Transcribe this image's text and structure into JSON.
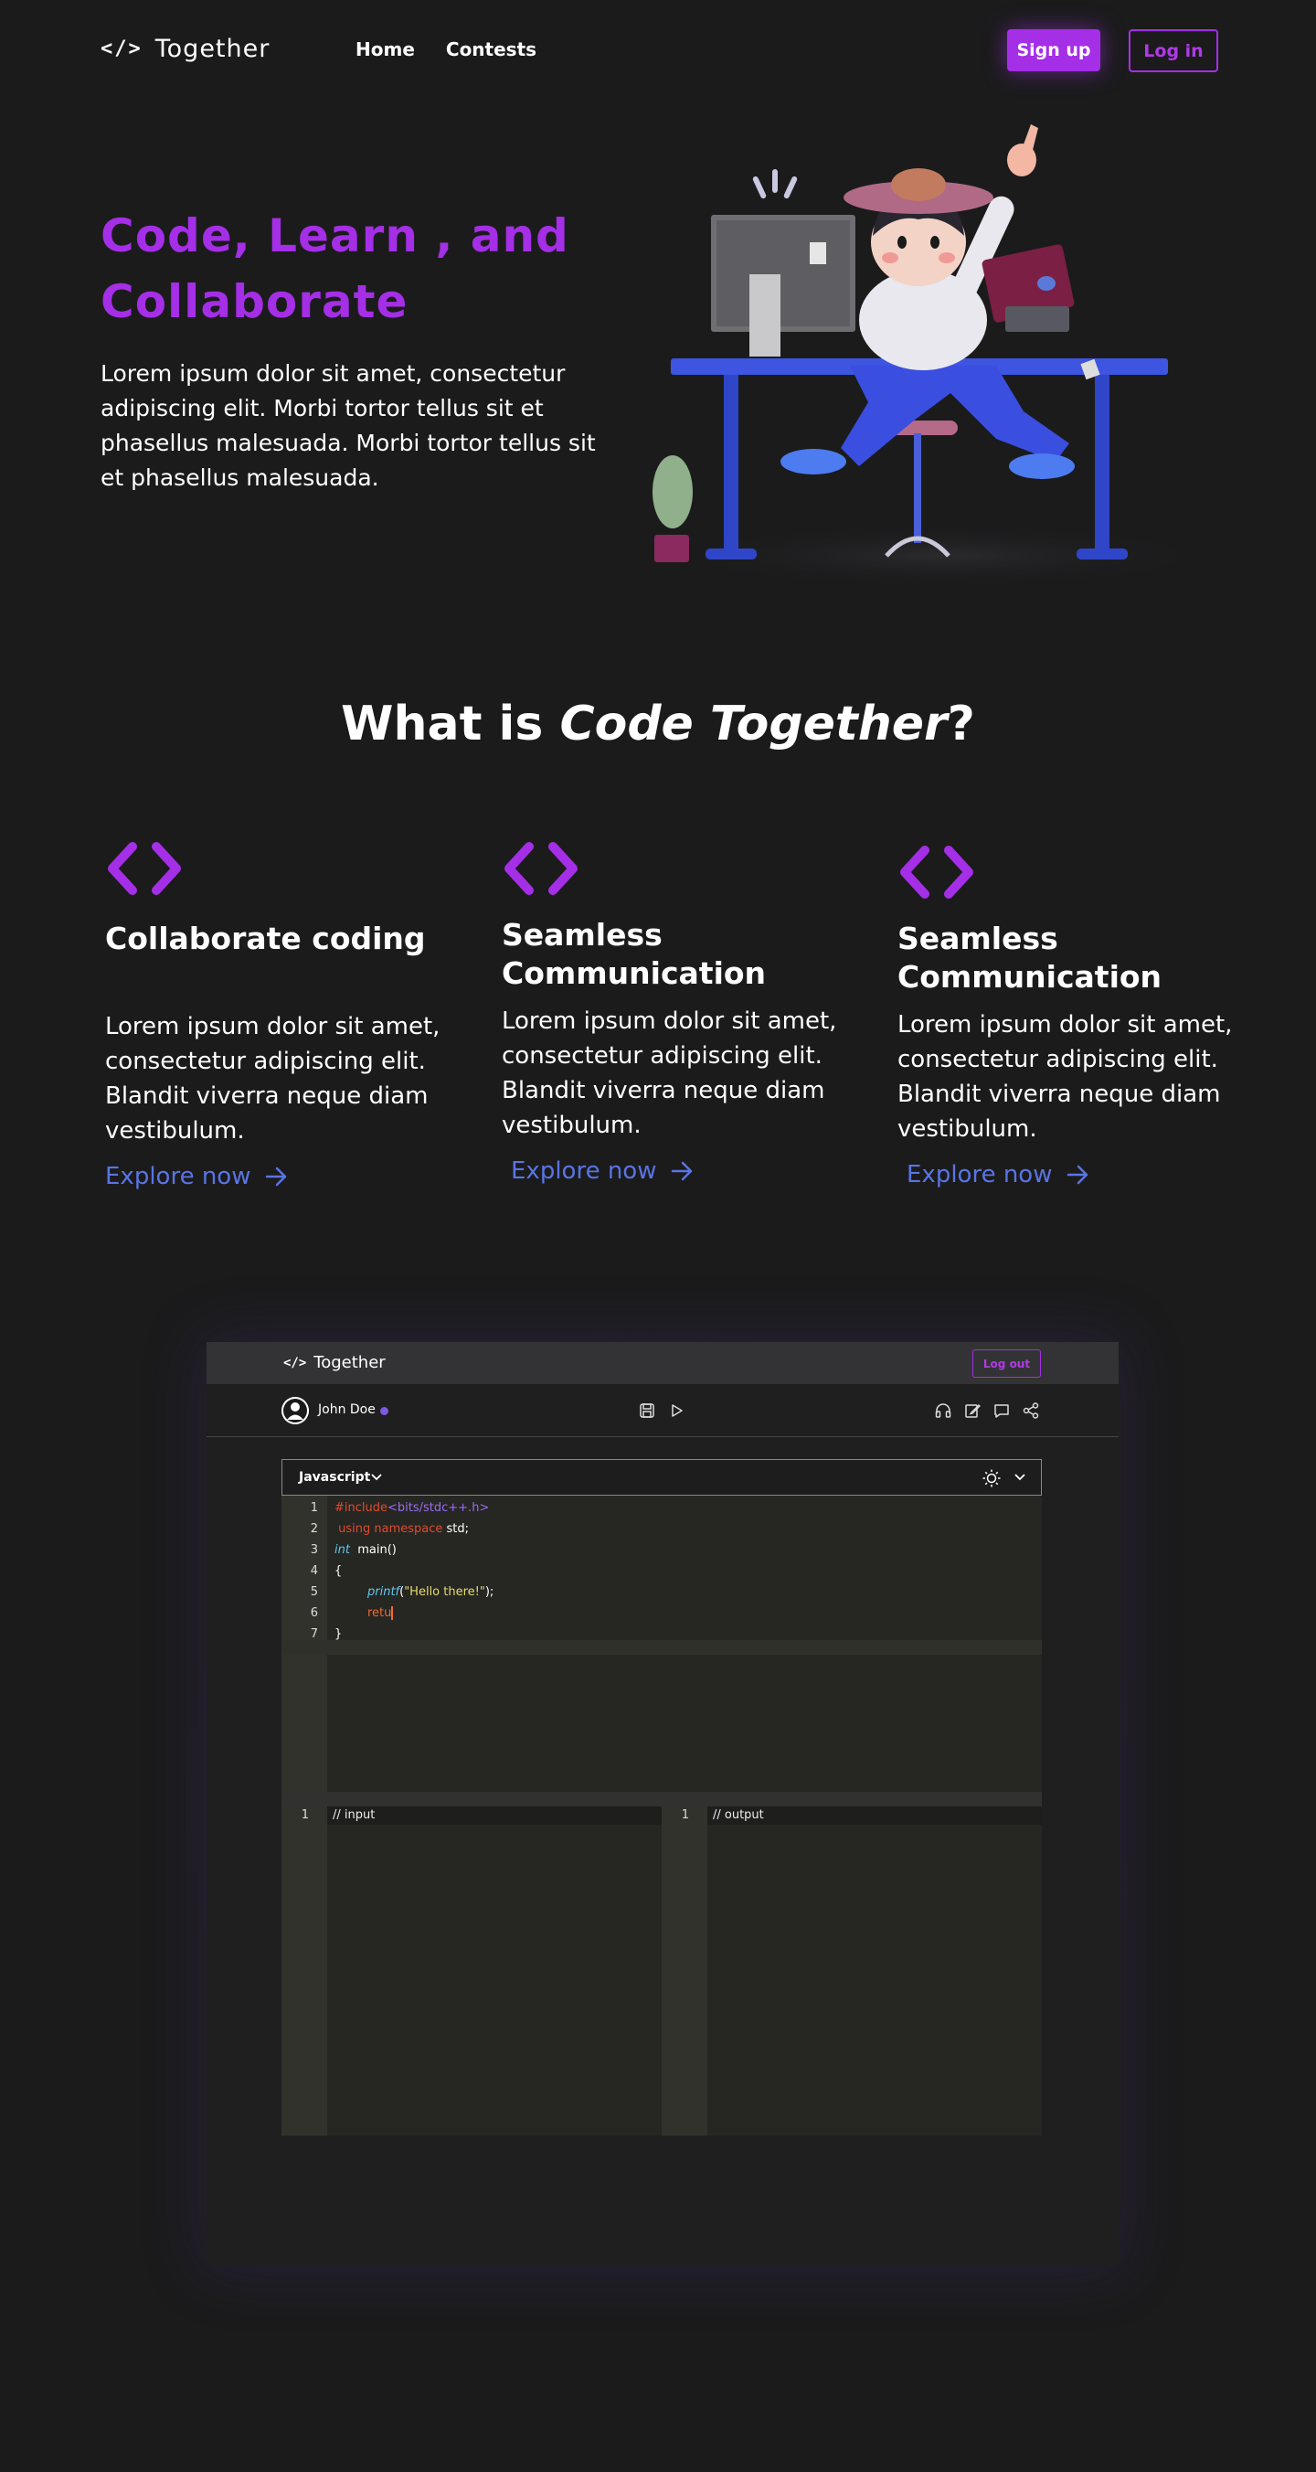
{
  "nav": {
    "logo_glyph": "</>",
    "logo_text": "Together",
    "links": [
      "Home",
      "Contests"
    ],
    "signup_label": "Sign up",
    "login_label": "Log in"
  },
  "hero": {
    "title_line1": "Code, Learn , and",
    "title_line2": "Collaborate",
    "body": "Lorem ipsum dolor sit amet, consectetur adipiscing elit. Morbi tortor tellus sit et phasellus malesuada. Morbi tortor tellus sit et phasellus malesuada."
  },
  "what": {
    "prefix": "What is ",
    "brand": "Code Together",
    "suffix": "?"
  },
  "features": [
    {
      "title": "Collaborate coding",
      "body": "Lorem ipsum dolor sit amet, consectetur adipiscing elit. Blandit viverra neque diam vestibulum.",
      "link": "Explore now"
    },
    {
      "title": "Seamless Communication",
      "body": "Lorem ipsum dolor sit amet, consectetur adipiscing elit. Blandit viverra neque diam vestibulum.",
      "link": "Explore now"
    },
    {
      "title": "Seamless Communication",
      "body": "Lorem ipsum dolor sit amet, consectetur adipiscing elit. Blandit viverra neque diam vestibulum.",
      "link": "Explore now"
    }
  ],
  "app": {
    "logo_glyph": "</>",
    "logo_text": "Together",
    "logout_label": "Log out",
    "user_name": "John Doe",
    "language": "Javascript",
    "code_lines": [
      {
        "num": "1",
        "parts": [
          "#include",
          "<bits/stdc++.h>"
        ]
      },
      {
        "num": "2",
        "parts": [
          " using namespace",
          " std;"
        ]
      },
      {
        "num": "3",
        "parts": [
          "int",
          "  main()"
        ]
      },
      {
        "num": "4",
        "parts": [
          "{"
        ]
      },
      {
        "num": "5",
        "parts": [
          "printf",
          "(",
          "\"Hello there!\"",
          ");"
        ]
      },
      {
        "num": "6",
        "parts": [
          "retu"
        ]
      },
      {
        "num": "7",
        "parts": [
          "}"
        ]
      }
    ],
    "input_num": "1",
    "input_text": "// input",
    "output_num": "1",
    "output_text": "// output"
  },
  "colors": {
    "accent": "#a52ee7",
    "link": "#5a74e4",
    "background": "#1b1b1c"
  }
}
